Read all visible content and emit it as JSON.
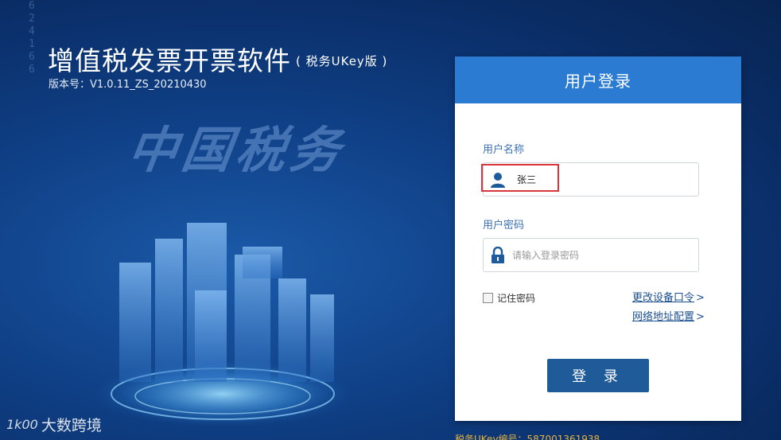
{
  "background": {
    "digits": "624166",
    "calligraphy": "中国税务"
  },
  "app": {
    "title": "增值税发票开票软件",
    "subtitle": "( 税务UKey版 )",
    "version": "版本号：V1.0.11_ZS_20210430"
  },
  "login": {
    "header": "用户登录",
    "username_label": "用户名称",
    "username_value": "张三",
    "password_label": "用户密码",
    "password_placeholder": "请输入登录密码",
    "remember_label": "记住密码",
    "change_pin_link": "更改设备口令",
    "network_config_link": "网络地址配置",
    "link_arrow": ">",
    "login_button": "登 录"
  },
  "footer": {
    "ukey_number": "税务UKey编号：587001361938"
  },
  "watermark": {
    "logo": "1k00",
    "text": "大数跨境"
  },
  "colors": {
    "header_blue": "#2a7bd1",
    "button_blue": "#1f5a99",
    "link_blue": "#1b4f8f",
    "highlight_red": "#d9363e",
    "ukey_gold": "#e5b33c"
  }
}
